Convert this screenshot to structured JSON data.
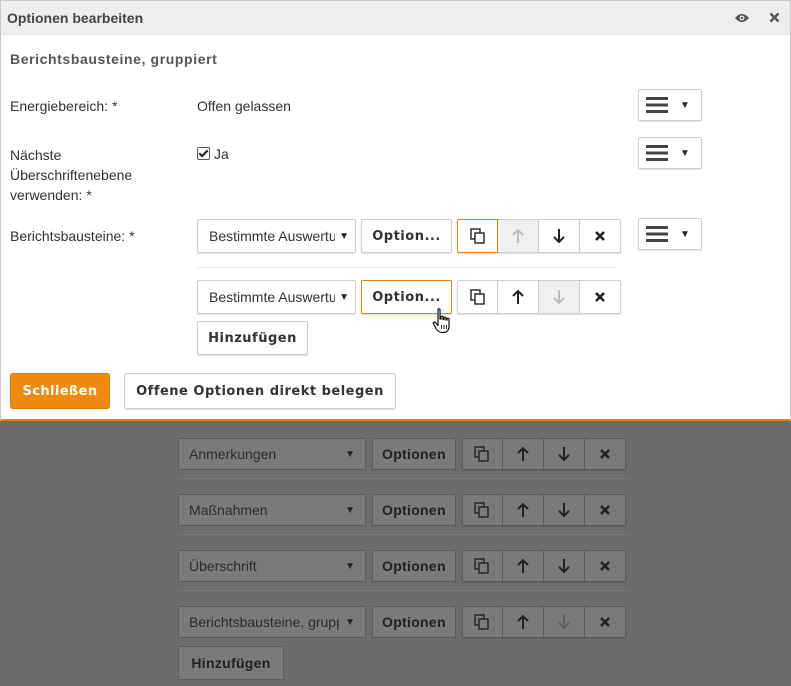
{
  "dialog": {
    "title": "Optionen bearbeiten",
    "icons": [
      "eye-icon",
      "close-icon"
    ],
    "subtitle": "Berichtsbausteine, gruppiert",
    "fields": {
      "energiebereich": {
        "label": "Energiebereich: *",
        "value": "Offen gelassen"
      },
      "ueberschriftenebene": {
        "label_lines": [
          "Nächste",
          "Überschriftenebene",
          "verwenden: *"
        ],
        "checkbox_checked": true,
        "checkbox_label": "Ja"
      },
      "berichtsbausteine": {
        "label": "Berichtsbausteine: *",
        "rows": [
          {
            "select_value": "Bestimmte Auswertung",
            "options_label": "Option..."
          },
          {
            "select_value": "Bestimmte Auswertung",
            "options_label": "Option..."
          }
        ],
        "add_label": "Hinzufügen"
      }
    },
    "footer": {
      "close_label": "Schließen",
      "assign_label": "Offene Optionen direkt belegen"
    },
    "accent_color": "#f08a0c"
  },
  "background": {
    "rows": [
      {
        "select_value": "Anmerkungen",
        "options_label": "Optionen"
      },
      {
        "select_value": "Maßnahmen",
        "options_label": "Optionen"
      },
      {
        "select_value": "Überschrift",
        "options_label": "Optionen"
      },
      {
        "select_value": "Berichtsbausteine, gruppiert",
        "options_label": "Optionen"
      }
    ],
    "add_label": "Hinzufügen"
  }
}
